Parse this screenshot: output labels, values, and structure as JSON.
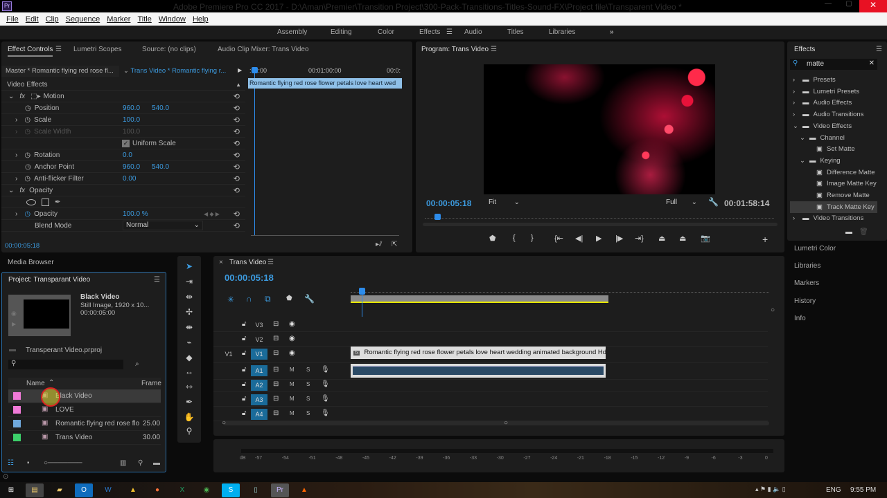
{
  "window": {
    "title": "Adobe Premiere Pro CC 2017 - D:\\Aman\\Premier\\Transition Project\\300-Pack-Transitions-Titles-Sound-FX\\Project file\\Transparent Video *",
    "app_icon": "Pr"
  },
  "menu": [
    "File",
    "Edit",
    "Clip",
    "Sequence",
    "Marker",
    "Title",
    "Window",
    "Help"
  ],
  "workspaces": [
    "Assembly",
    "Editing",
    "Color",
    "Effects",
    "Audio",
    "Titles",
    "Libraries"
  ],
  "workspace_active": "Effects",
  "accent": "#3c9be0",
  "effect_controls": {
    "tabs": [
      "Effect Controls",
      "Lumetri Scopes",
      "Source: (no clips)",
      "Audio Clip Mixer: Trans Video"
    ],
    "master": "Master * Romantic flying red rose fl...",
    "sequence_clip": "Trans Video * Romantic flying r...",
    "ruler": [
      ":00:00",
      "00:01:00:00",
      "00:0:"
    ],
    "clip_bar": "Romantic flying red rose flower petals love heart wed",
    "section": "Video Effects",
    "motion": "Motion",
    "props": [
      {
        "name": "Position",
        "v1": "960.0",
        "v2": "540.0"
      },
      {
        "name": "Scale",
        "v1": "100.0"
      },
      {
        "name": "Scale Width",
        "v1": "100.0"
      },
      {
        "name": "Uniform Scale"
      },
      {
        "name": "Rotation",
        "v1": "0.0"
      },
      {
        "name": "Anchor Point",
        "v1": "960.0",
        "v2": "540.0"
      },
      {
        "name": "Anti-flicker Filter",
        "v1": "0.00"
      }
    ],
    "opacity": "Opacity",
    "opacity_value": "100.0 %",
    "blend_mode_label": "Blend Mode",
    "blend_mode": "Normal",
    "timecode": "00:00:05:18"
  },
  "program": {
    "title": "Program: Trans Video",
    "timecode": "00:00:05:18",
    "fit": "Fit",
    "quality": "Full",
    "duration": "00:01:58:14"
  },
  "effects": {
    "title": "Effects",
    "search": "matte",
    "tree": [
      {
        "label": "Presets",
        "depth": 0,
        "type": "folder"
      },
      {
        "label": "Lumetri Presets",
        "depth": 0,
        "type": "folder"
      },
      {
        "label": "Audio Effects",
        "depth": 0,
        "type": "folder"
      },
      {
        "label": "Audio Transitions",
        "depth": 0,
        "type": "folder"
      },
      {
        "label": "Video Effects",
        "depth": 0,
        "type": "folder",
        "open": true
      },
      {
        "label": "Channel",
        "depth": 1,
        "type": "folder",
        "open": true
      },
      {
        "label": "Set Matte",
        "depth": 2,
        "type": "effect"
      },
      {
        "label": "Keying",
        "depth": 1,
        "type": "folder",
        "open": true
      },
      {
        "label": "Difference Matte",
        "depth": 2,
        "type": "effect"
      },
      {
        "label": "Image Matte Key",
        "depth": 2,
        "type": "effect"
      },
      {
        "label": "Remove Matte",
        "depth": 2,
        "type": "effect"
      },
      {
        "label": "Track Matte Key",
        "depth": 2,
        "type": "effect",
        "selected": true
      },
      {
        "label": "Video Transitions",
        "depth": 0,
        "type": "folder"
      }
    ],
    "side_panels": [
      "Lumetri Color",
      "Libraries",
      "Markers",
      "History",
      "Info"
    ]
  },
  "project": {
    "media_browser": "Media Browser",
    "title": "Project: Transparant Video",
    "preview": {
      "name": "Black Video",
      "info": "Still Image, 1920 x 10...",
      "duration": "00:00:05:00"
    },
    "file": "Transperant Video.prproj",
    "columns": [
      "Name",
      "Frame"
    ],
    "items": [
      {
        "name": "Black Video",
        "frame": "",
        "color": "#f07ad8"
      },
      {
        "name": "LOVE",
        "frame": "",
        "color": "#f07ad8"
      },
      {
        "name": "Romantic flying red rose flo",
        "frame": "25.00",
        "color": "#6fa8dc"
      },
      {
        "name": "Trans Video",
        "frame": "30.00",
        "color": "#3ccf6a"
      }
    ]
  },
  "timeline": {
    "title": "Trans Video",
    "timecode": "00:00:05:18",
    "video_tracks": [
      "V3",
      "V2",
      "V1"
    ],
    "audio_tracks": [
      "A1",
      "A2",
      "A3",
      "A4"
    ],
    "source_patch": "V1",
    "mute": "M",
    "solo": "S",
    "clip": "Romantic flying red rose flower petals love heart wedding animated background Hd"
  },
  "meter": {
    "unit": "dB",
    "ticks": [
      "-57",
      "-54",
      "-51",
      "-48",
      "-45",
      "-42",
      "-39",
      "-36",
      "-33",
      "-30",
      "-27",
      "-24",
      "-21",
      "-18",
      "-15",
      "-12",
      "-9",
      "-6",
      "-3",
      "0"
    ]
  },
  "taskbar": {
    "lang": "ENG",
    "time": "9:55 PM"
  }
}
